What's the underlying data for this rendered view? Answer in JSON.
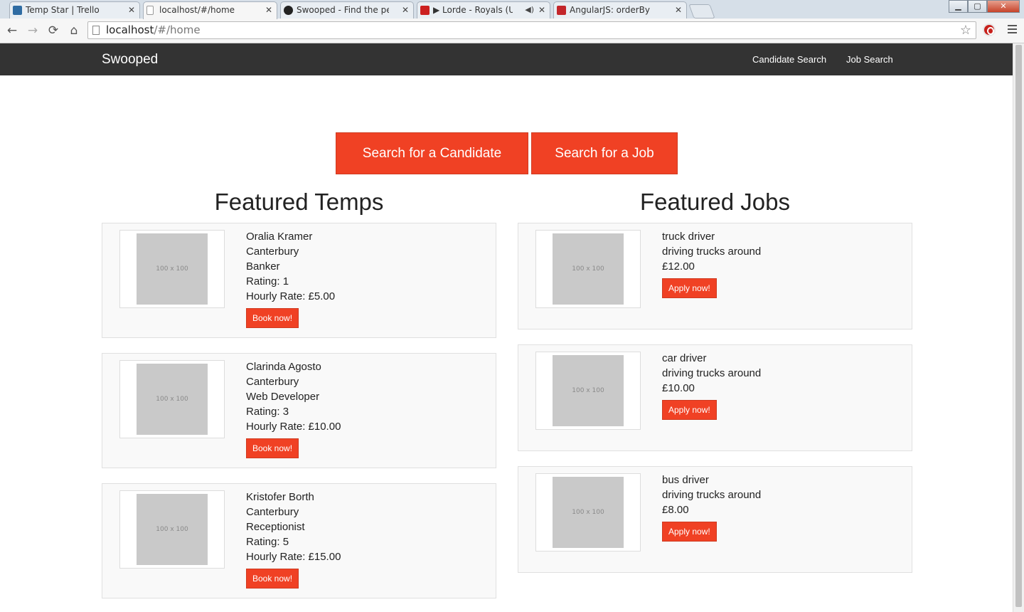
{
  "browser": {
    "tabs": [
      {
        "title": "Temp Star | Trello",
        "icon_color": "#2f6ca3"
      },
      {
        "title": "localhost/#/home",
        "icon_color": "#ffffff"
      },
      {
        "title": "Swooped - Find the perfect",
        "icon_color": "#222222"
      },
      {
        "title": "▶ Lorde - Royals (US V",
        "icon_color": "#cc2020"
      },
      {
        "title": "AngularJS: orderBy",
        "icon_color": "#c3262b"
      }
    ],
    "url_host": "localhost",
    "url_path": "/#/home",
    "window_buttons": {
      "minimize": "▁",
      "maximize": "▢",
      "close": "✕"
    },
    "nav": {
      "back": "←",
      "forward": "→",
      "reload": "⟳",
      "home": "⌂",
      "star": "☆"
    }
  },
  "navbar": {
    "brand": "Swooped",
    "links": [
      "Candidate Search",
      "Job Search"
    ]
  },
  "hero": {
    "candidate_button": "Search for a Candidate",
    "job_button": "Search for a Job"
  },
  "featured_temps": {
    "title": "Featured Temps",
    "items": [
      {
        "image": "100 x 100",
        "name": "Oralia Kramer",
        "location": "Canterbury",
        "role": "Banker",
        "rating": "Rating: 1",
        "rate": "Hourly Rate: £5.00",
        "button": "Book now!"
      },
      {
        "image": "100 x 100",
        "name": "Clarinda Agosto",
        "location": "Canterbury",
        "role": "Web Developer",
        "rating": "Rating: 3",
        "rate": "Hourly Rate: £10.00",
        "button": "Book now!"
      },
      {
        "image": "100 x 100",
        "name": "Kristofer Borth",
        "location": "Canterbury",
        "role": "Receptionist",
        "rating": "Rating: 5",
        "rate": "Hourly Rate: £15.00",
        "button": "Book now!"
      }
    ]
  },
  "featured_jobs": {
    "title": "Featured Jobs",
    "items": [
      {
        "image": "100 x 100",
        "title": "truck driver",
        "description": "driving trucks around",
        "pay": "£12.00",
        "button": "Apply now!"
      },
      {
        "image": "100 x 100",
        "title": "car driver",
        "description": "driving trucks around",
        "pay": "£10.00",
        "button": "Apply now!"
      },
      {
        "image": "100 x 100",
        "title": "bus driver",
        "description": "driving trucks around",
        "pay": "£8.00",
        "button": "Apply now!"
      }
    ]
  },
  "colors": {
    "accent": "#f04124",
    "navbar": "#333333",
    "card_bg": "#f9f9f9"
  }
}
